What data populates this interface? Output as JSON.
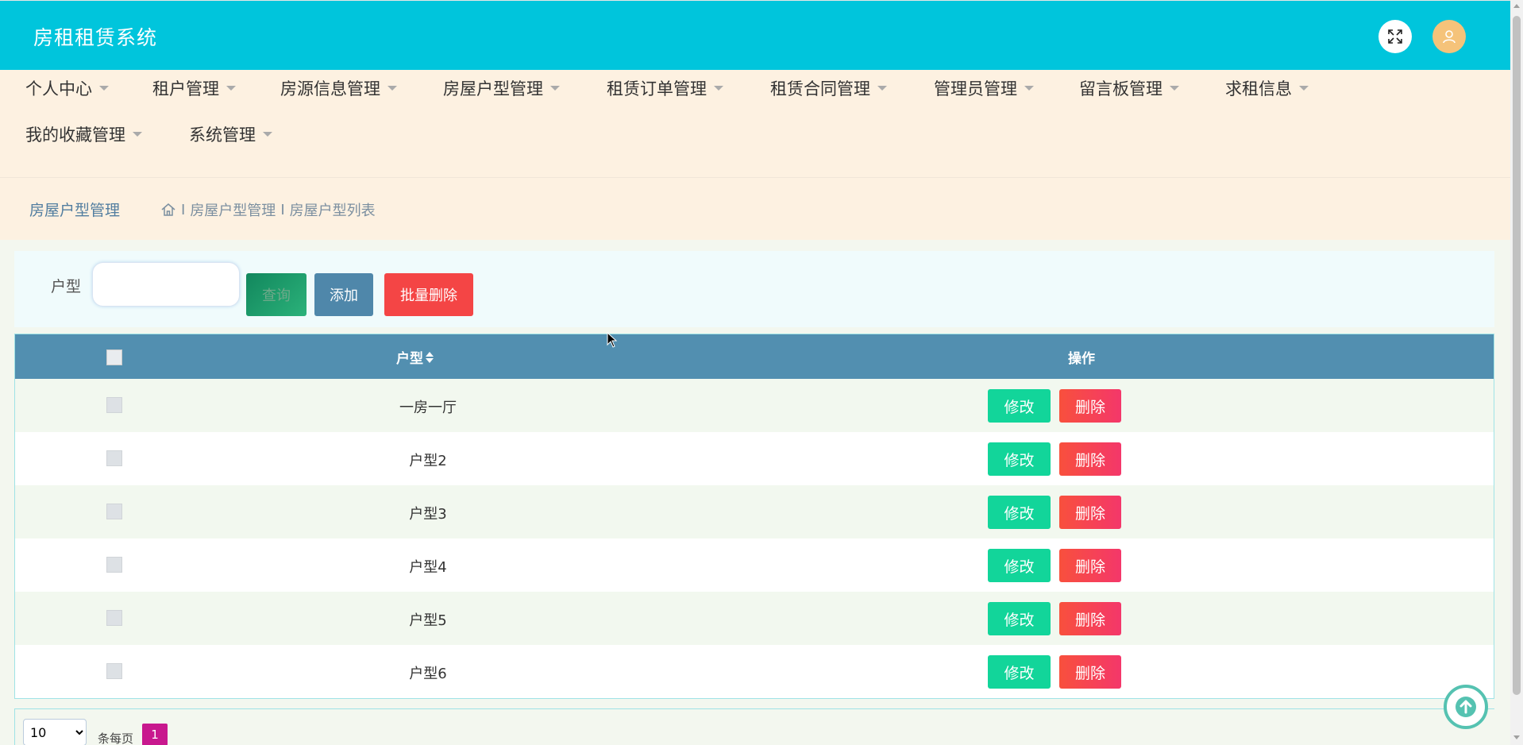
{
  "app": {
    "title": "房租租赁系统"
  },
  "header": {
    "fullscreen_icon": "expand-icon",
    "user_icon": "user-icon"
  },
  "menu": {
    "items": [
      {
        "label": "个人中心"
      },
      {
        "label": "租户管理"
      },
      {
        "label": "房源信息管理"
      },
      {
        "label": "房屋户型管理"
      },
      {
        "label": "租赁订单管理"
      },
      {
        "label": "租赁合同管理"
      },
      {
        "label": "管理员管理"
      },
      {
        "label": "留言板管理"
      },
      {
        "label": "求租信息"
      },
      {
        "label": "我的收藏管理"
      },
      {
        "label": "系统管理"
      }
    ]
  },
  "breadcrumb": {
    "title": "房屋户型管理",
    "items": [
      "房屋户型管理",
      "房屋户型列表"
    ],
    "separator": "I"
  },
  "search": {
    "label": "户型",
    "value": "",
    "placeholder": "",
    "query_label": "查询",
    "add_label": "添加",
    "bulk_delete_label": "批量删除"
  },
  "table": {
    "columns": {
      "type": "户型",
      "actions": "操作"
    },
    "rows": [
      {
        "type": "一房一厅"
      },
      {
        "type": "户型2"
      },
      {
        "type": "户型3"
      },
      {
        "type": "户型4"
      },
      {
        "type": "户型5"
      },
      {
        "type": "户型6"
      }
    ],
    "edit_label": "修改",
    "delete_label": "删除"
  },
  "pagination": {
    "page_size": "10",
    "per_page_label": "条每页",
    "current_page": "1"
  },
  "colors": {
    "header": "#00c5dc",
    "menu_bg": "#fdf1e1",
    "table_head": "#528fb0",
    "edit": "#12d59a",
    "delete": "#f44545",
    "page_active": "#c8188e"
  }
}
